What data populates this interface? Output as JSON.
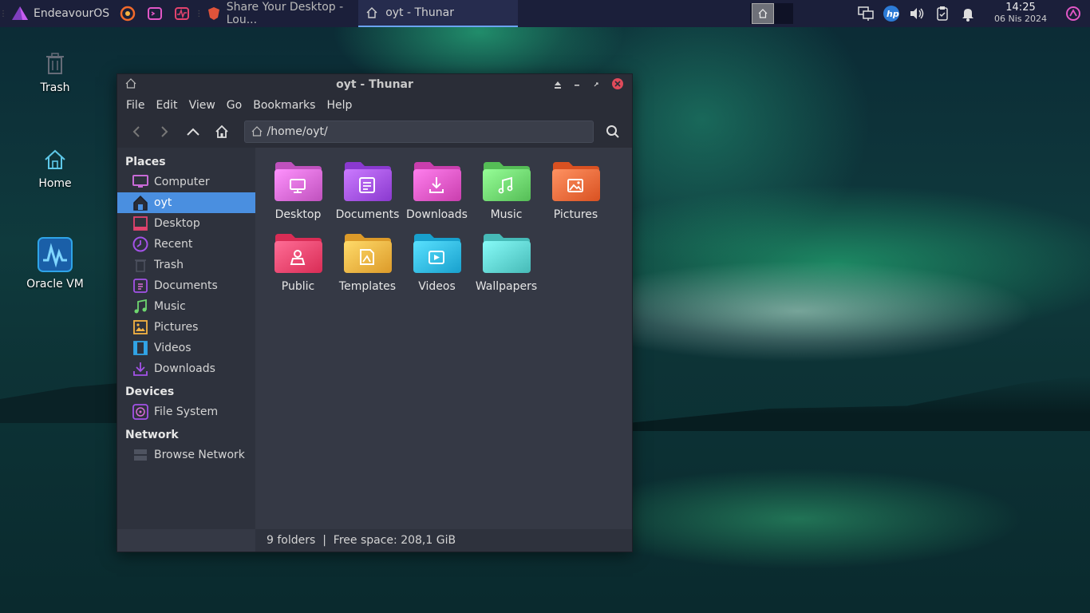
{
  "taskbar": {
    "items": [
      {
        "label": "EndeavourOS"
      },
      {
        "label": ""
      },
      {
        "label": ""
      },
      {
        "label": ""
      },
      {
        "label": "Share Your Desktop - Lou..."
      },
      {
        "label": "oyt - Thunar"
      }
    ],
    "clock": {
      "time": "14:25",
      "date": "06 Nis 2024"
    }
  },
  "desktop": {
    "icons": [
      {
        "label": "Trash"
      },
      {
        "label": "Home"
      },
      {
        "label": "Oracle VM"
      }
    ]
  },
  "window": {
    "title": "oyt - Thunar",
    "menu": [
      "File",
      "Edit",
      "View",
      "Go",
      "Bookmarks",
      "Help"
    ],
    "location": "/home/oyt/",
    "sidebar": {
      "places_header": "Places",
      "places": [
        "Computer",
        "oyt",
        "Desktop",
        "Recent",
        "Trash",
        "Documents",
        "Music",
        "Pictures",
        "Videos",
        "Downloads"
      ],
      "devices_header": "Devices",
      "devices": [
        "File System"
      ],
      "network_header": "Network",
      "network": [
        "Browse Network"
      ]
    },
    "folders": [
      {
        "label": "Desktop",
        "color": "#d86ad6"
      },
      {
        "label": "Documents",
        "color": "#a352e8"
      },
      {
        "label": "Downloads",
        "color": "#e257c6"
      },
      {
        "label": "Music",
        "color": "#6ed66f"
      },
      {
        "label": "Pictures",
        "color": "#f26a3a"
      },
      {
        "label": "Public",
        "color": "#f2456e"
      },
      {
        "label": "Templates",
        "color": "#f5b342"
      },
      {
        "label": "Videos",
        "color": "#31b9e6"
      },
      {
        "label": "Wallpapers",
        "color": "#5fd3d0"
      }
    ],
    "status": "9 folders  |  Free space: 208,1 GiB"
  }
}
